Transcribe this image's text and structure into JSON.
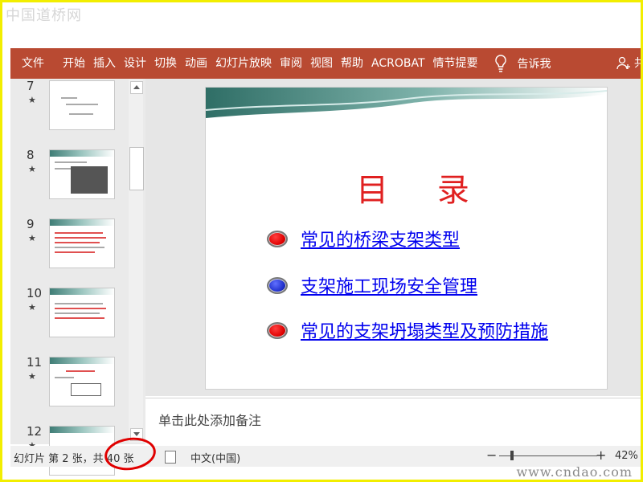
{
  "watermark": {
    "top": "中国道桥网",
    "bottom": "www.cndao.com"
  },
  "ribbon": {
    "tabs": [
      "文件",
      "开始",
      "插入",
      "设计",
      "切换",
      "动画",
      "幻灯片放映",
      "审阅",
      "视图",
      "帮助",
      "ACROBAT",
      "情节提要"
    ],
    "tell_me": "告诉我",
    "share": "共"
  },
  "thumbnails": [
    {
      "number": "7",
      "star": "★"
    },
    {
      "number": "8",
      "star": "★"
    },
    {
      "number": "9",
      "star": "★"
    },
    {
      "number": "10",
      "star": "★"
    },
    {
      "number": "11",
      "star": "★"
    },
    {
      "number": "12",
      "star": "★"
    }
  ],
  "slide": {
    "title": "目 录",
    "items": [
      "常见的桥梁支架类型",
      "支架施工现场安全管理",
      "常见的支架坍塌类型及预防措施"
    ]
  },
  "notes": {
    "placeholder": "单击此处添加备注"
  },
  "status": {
    "slide_info": "幻灯片 第 2 张，共 40 张",
    "language": "中文(中国)",
    "zoom": "42%",
    "zoom_minus": "−",
    "zoom_plus": "+"
  },
  "colors": {
    "ribbon": "#b94a32",
    "title": "#e02020",
    "link": "#0000ee",
    "highlight": "#f2ee00"
  }
}
